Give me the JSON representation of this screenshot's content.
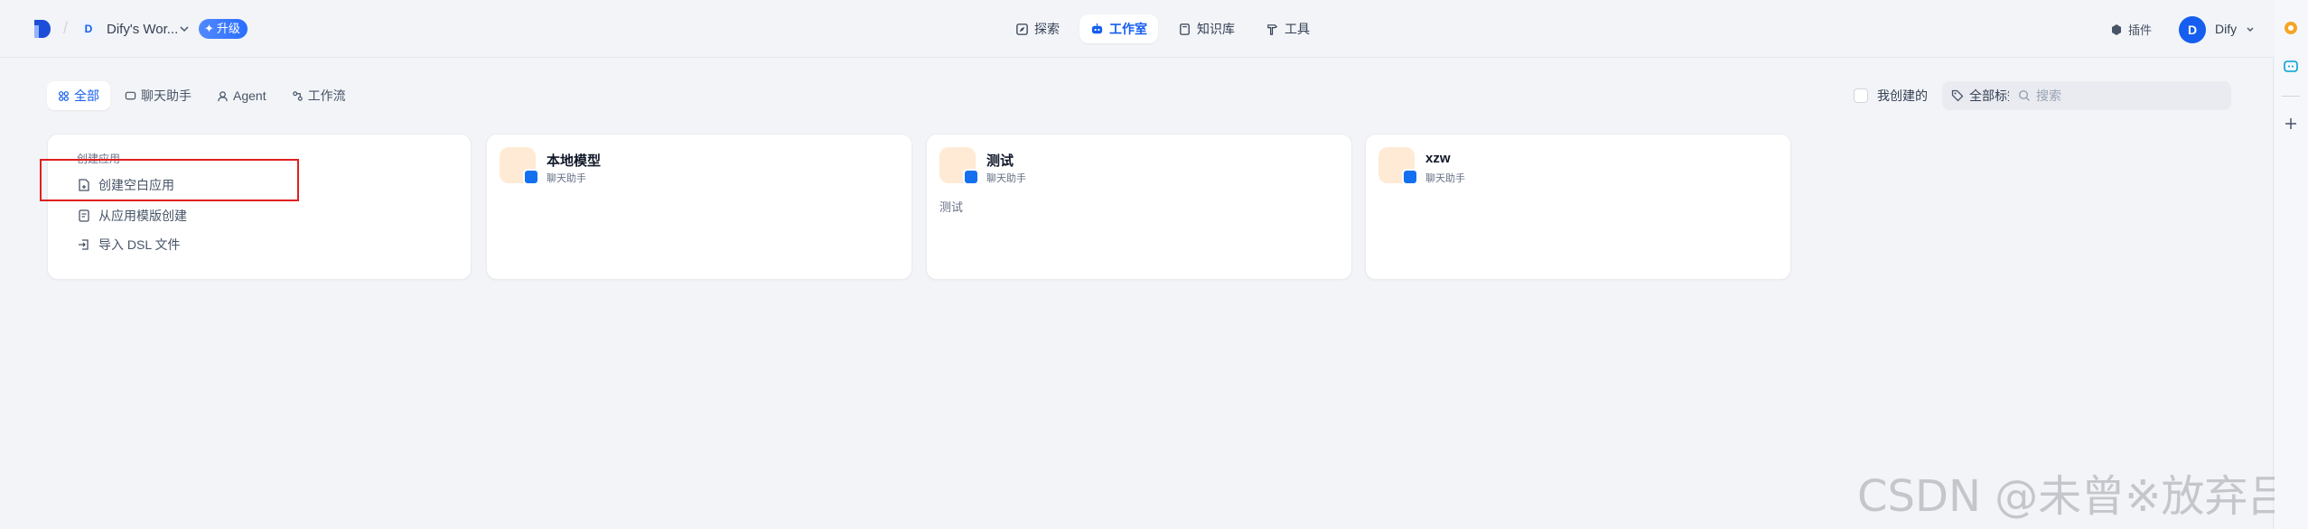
{
  "header": {
    "workspace_initial": "D",
    "workspace_name": "Dify's Wor...",
    "upgrade_label": "升级",
    "nav": [
      {
        "label": "探索",
        "icon": "compass-icon"
      },
      {
        "label": "工作室",
        "icon": "robot-icon",
        "active": true
      },
      {
        "label": "知识库",
        "icon": "book-icon"
      },
      {
        "label": "工具",
        "icon": "hammer-icon"
      }
    ],
    "plugin_label": "插件",
    "user_initial": "D",
    "user_name": "Dify"
  },
  "filters": {
    "tabs": [
      {
        "label": "全部",
        "icon": "grid-icon",
        "active": true
      },
      {
        "label": "聊天助手",
        "icon": "chat-icon"
      },
      {
        "label": "Agent",
        "icon": "agent-icon"
      },
      {
        "label": "工作流",
        "icon": "workflow-icon"
      }
    ],
    "mine_label": "我创建的",
    "tags_label": "全部标签",
    "search_placeholder": "搜索"
  },
  "create_card": {
    "title": "创建应用",
    "options": [
      {
        "label": "创建空白应用",
        "icon": "file-plus-icon"
      },
      {
        "label": "从应用模版创建",
        "icon": "template-icon"
      },
      {
        "label": "导入 DSL 文件",
        "icon": "import-icon"
      }
    ]
  },
  "apps": [
    {
      "name": "本地模型",
      "type": "聊天助手",
      "description": ""
    },
    {
      "name": "测试",
      "type": "聊天助手",
      "description": "测试"
    },
    {
      "name": "xzw",
      "type": "聊天助手",
      "description": ""
    }
  ],
  "colors": {
    "accent": "#155eef",
    "highlight_box": "#e02020",
    "app_icon_bg": "#ffead5"
  },
  "watermark": "CSDN @未曾※放弃吕"
}
